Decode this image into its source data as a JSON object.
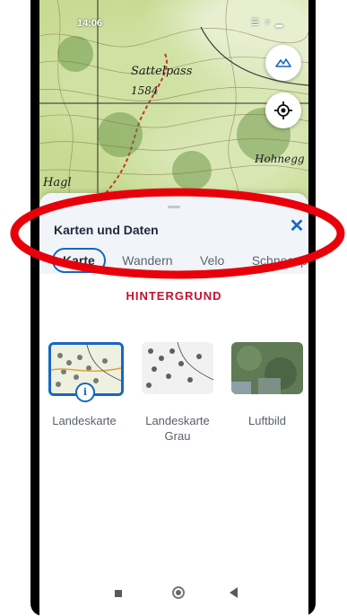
{
  "status_bar": {
    "time": "14:06",
    "icons": "☰ ▿ ▂"
  },
  "map": {
    "labels": {
      "pass_name": "Sattelpass",
      "pass_elevation": "1584",
      "place_right": "Hohnegg",
      "place_left": "Hagl"
    },
    "buttons": {
      "layers_icon": "layers-icon",
      "locate_icon": "locate-icon"
    }
  },
  "panel": {
    "title": "Karten und Daten",
    "close_label": "✕",
    "tabs": [
      {
        "label": "Karte",
        "active": true
      },
      {
        "label": "Wandern",
        "active": false
      },
      {
        "label": "Velo",
        "active": false
      },
      {
        "label": "Schneesport",
        "active": false
      }
    ],
    "section_title": "HINTERGRUND",
    "backgrounds": [
      {
        "label": "Landeskarte",
        "selected": true,
        "info": "i"
      },
      {
        "label": "Landeskarte Grau",
        "selected": false
      },
      {
        "label": "Luftbild",
        "selected": false
      }
    ]
  },
  "navbar": {
    "recents": "recents-icon",
    "home": "home-icon",
    "back": "back-icon"
  },
  "colors": {
    "accent": "#1766c4",
    "section": "#c8102e",
    "annotation": "#e8000b"
  }
}
